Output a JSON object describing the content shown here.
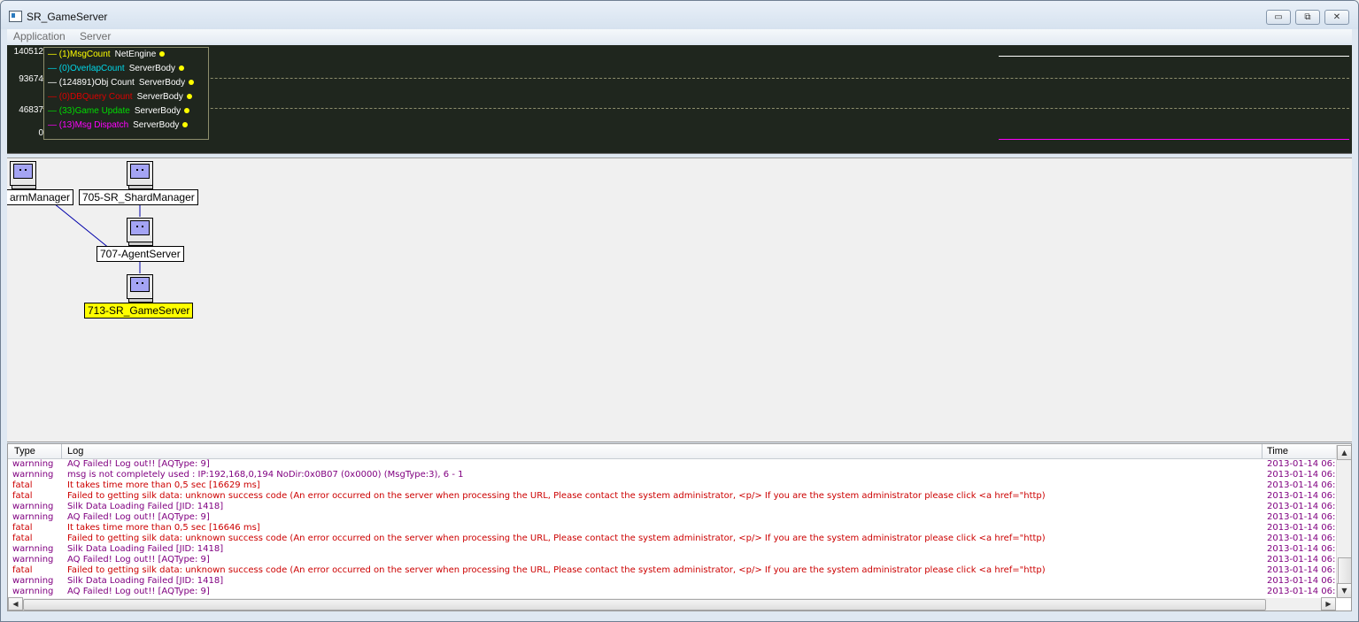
{
  "window": {
    "title": "SR_GameServer",
    "btn_min": "▭",
    "btn_max": "⧉",
    "btn_close": "✕"
  },
  "menu": {
    "items": [
      "Application",
      "Server"
    ]
  },
  "graph": {
    "y_labels": [
      "140512",
      "93674",
      "46837",
      "0"
    ],
    "legend": [
      {
        "name": "(1)MsgCount",
        "source": "NetEngine",
        "color": "#ffff00"
      },
      {
        "name": "(0)OverlapCount",
        "source": "ServerBody",
        "color": "#00d7e8"
      },
      {
        "name": "(124891)Obj Count",
        "source": "ServerBody",
        "color": "#ffffff"
      },
      {
        "name": "(0)DBQuery Count",
        "source": "ServerBody",
        "color": "#dd0000"
      },
      {
        "name": "(33)Game Update",
        "source": "ServerBody",
        "color": "#00dd00"
      },
      {
        "name": "(13)Msg Dispatch",
        "source": "ServerBody",
        "color": "#ff00ff"
      }
    ]
  },
  "topology": {
    "nodes": [
      {
        "label": "armManager",
        "selected": false
      },
      {
        "label": "705-SR_ShardManager",
        "selected": false
      },
      {
        "label": "707-AgentServer",
        "selected": false
      },
      {
        "label": "713-SR_GameServer",
        "selected": true
      }
    ]
  },
  "log": {
    "columns": {
      "type": "Type",
      "log": "Log",
      "time": "Time"
    },
    "rows": [
      {
        "type": "warnning",
        "log": "AQ Failed! Log out!! [AQType: 9]",
        "time": "2013-01-14 06:",
        "severity": "warn"
      },
      {
        "type": "warnning",
        "log": "msg is not completely used : IP:192,168,0,194 NoDir:0x0B07 (0x0000) (MsgType:3), 6 - 1",
        "time": "2013-01-14 06:",
        "severity": "warn"
      },
      {
        "type": "fatal",
        "log": "It takes time more than 0,5 sec [16629 ms]",
        "time": "2013-01-14 06:",
        "severity": "fatal"
      },
      {
        "type": "fatal",
        "log": "Failed to getting silk data: unknown success code (An error occurred on the server when processing the URL, Please contact the system administrator, <p/> If you are the system administrator please click <a href=\"http)",
        "time": "2013-01-14 06:",
        "severity": "fatal"
      },
      {
        "type": "warnning",
        "log": "Silk Data Loading Failed [JID: 1418]",
        "time": "2013-01-14 06:",
        "severity": "warn"
      },
      {
        "type": "warnning",
        "log": "AQ Failed! Log out!! [AQType: 9]",
        "time": "2013-01-14 06:",
        "severity": "warn"
      },
      {
        "type": "fatal",
        "log": "It takes time more than 0,5 sec [16646 ms]",
        "time": "2013-01-14 06:",
        "severity": "fatal"
      },
      {
        "type": "fatal",
        "log": "Failed to getting silk data: unknown success code (An error occurred on the server when processing the URL, Please contact the system administrator, <p/> If you are the system administrator please click <a href=\"http)",
        "time": "2013-01-14 06:",
        "severity": "fatal"
      },
      {
        "type": "warnning",
        "log": "Silk Data Loading Failed [JID: 1418]",
        "time": "2013-01-14 06:",
        "severity": "warn"
      },
      {
        "type": "warnning",
        "log": "AQ Failed! Log out!! [AQType: 9]",
        "time": "2013-01-14 06:",
        "severity": "warn"
      },
      {
        "type": "fatal",
        "log": "Failed to getting silk data: unknown success code (An error occurred on the server when processing the URL, Please contact the system administrator, <p/> If you are the system administrator please click <a href=\"http)",
        "time": "2013-01-14 06:",
        "severity": "fatal"
      },
      {
        "type": "warnning",
        "log": "Silk Data Loading Failed [JID: 1418]",
        "time": "2013-01-14 06:",
        "severity": "warn"
      },
      {
        "type": "warnning",
        "log": "AQ Failed! Log out!! [AQType: 9]",
        "time": "2013-01-14 06:",
        "severity": "warn"
      }
    ],
    "scroll": {
      "up": "▲",
      "down": "▼",
      "left": "◀",
      "right": "▶"
    }
  }
}
